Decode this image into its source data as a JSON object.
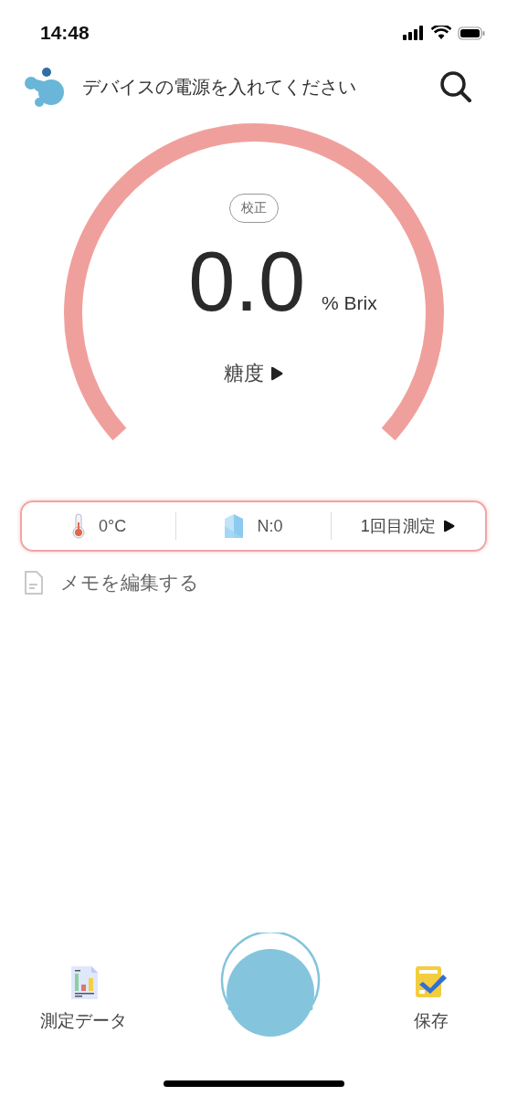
{
  "status_bar": {
    "time": "14:48"
  },
  "header": {
    "message": "デバイスの電源を入れてください"
  },
  "gauge": {
    "calibrate_button": "校正",
    "value": "0.0",
    "unit": "% Brix",
    "mode": "糖度"
  },
  "info_bar": [
    {
      "kind": "temperature",
      "text": "0°C"
    },
    {
      "kind": "count",
      "text": "N:0"
    },
    {
      "kind": "measurement",
      "text": "1回目測定"
    }
  ],
  "memo": {
    "label": "メモを編集する"
  },
  "bottom_nav": [
    {
      "kind": "data",
      "label": "測定データ"
    },
    {
      "kind": "measure"
    },
    {
      "kind": "save",
      "label": "保存"
    }
  ]
}
